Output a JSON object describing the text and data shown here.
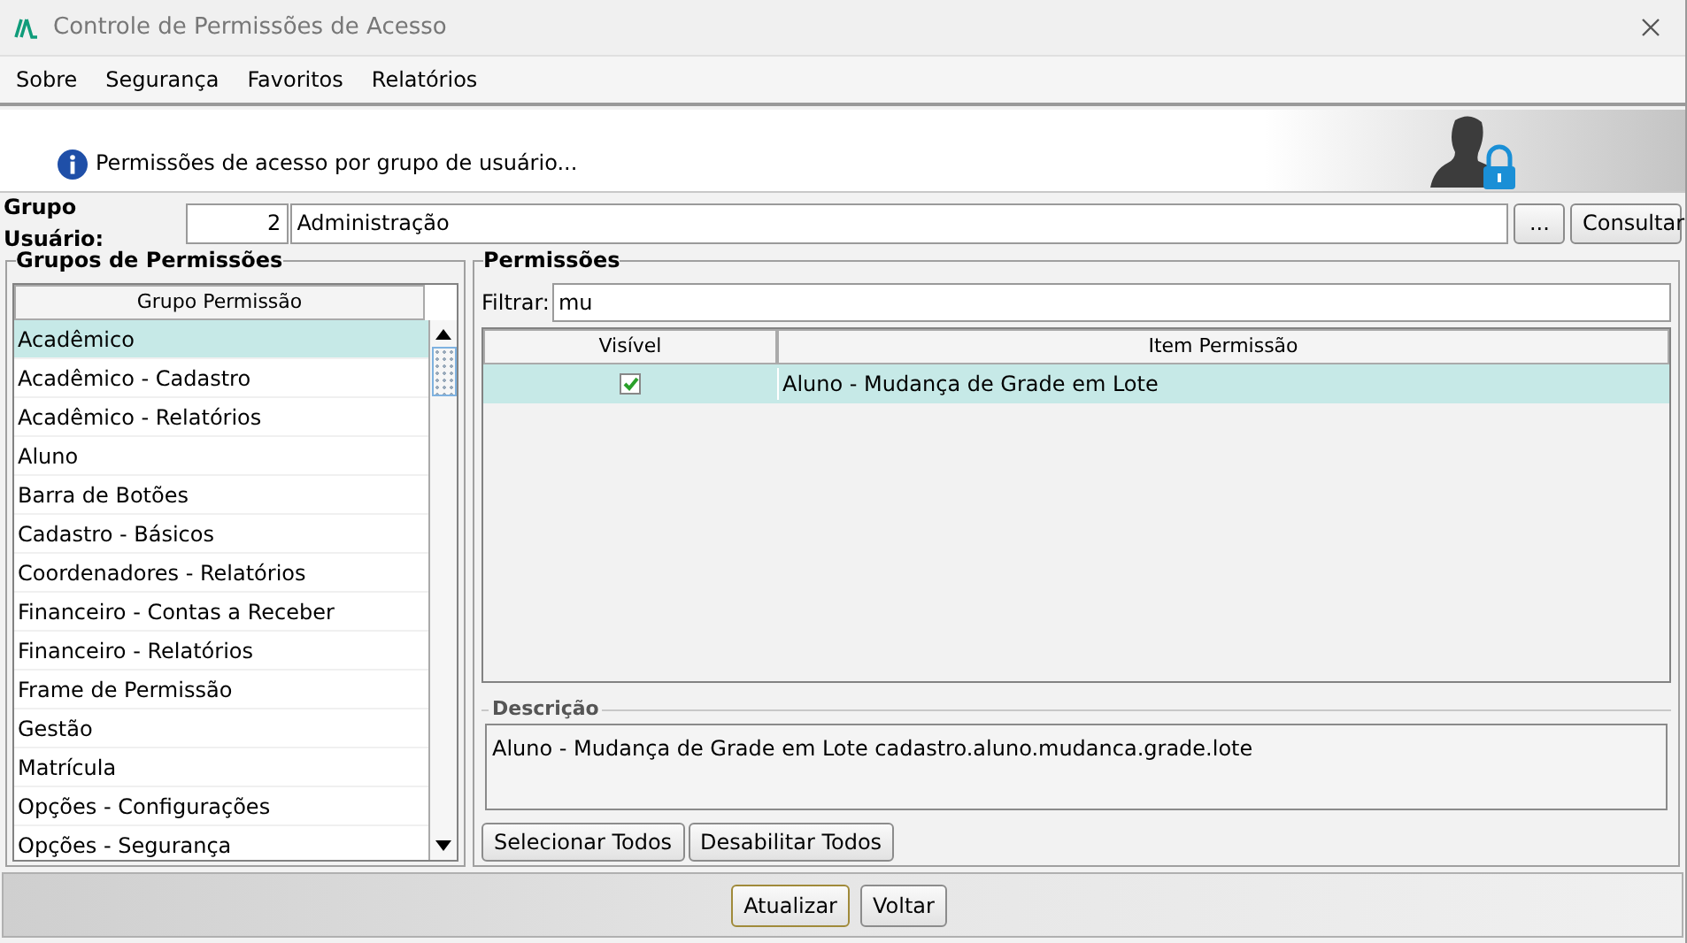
{
  "window": {
    "title": "Controle de Permissões de Acesso"
  },
  "menu": [
    "Sobre",
    "Segurança",
    "Favoritos",
    "Relatórios"
  ],
  "header": {
    "message": "Permissões de acesso por grupo de usuário..."
  },
  "user_group": {
    "label": "Grupo Usuário:",
    "code": "2",
    "name": "Administração",
    "browse_button": "...",
    "query_button": "Consultar"
  },
  "groups_panel": {
    "title": "Grupos de Permissões",
    "column": "Grupo Permissão",
    "items": [
      {
        "label": "Acadêmico",
        "selected": true
      },
      {
        "label": "Acadêmico - Cadastro",
        "selected": false
      },
      {
        "label": "Acadêmico - Relatórios",
        "selected": false
      },
      {
        "label": "Aluno",
        "selected": false
      },
      {
        "label": "Barra de Botões",
        "selected": false
      },
      {
        "label": "Cadastro - Básicos",
        "selected": false
      },
      {
        "label": "Coordenadores - Relatórios",
        "selected": false
      },
      {
        "label": "Financeiro - Contas a Receber",
        "selected": false
      },
      {
        "label": "Financeiro - Relatórios",
        "selected": false
      },
      {
        "label": "Frame de Permissão",
        "selected": false
      },
      {
        "label": "Gestão",
        "selected": false
      },
      {
        "label": "Matrícula",
        "selected": false
      },
      {
        "label": "Opções - Configurações",
        "selected": false
      },
      {
        "label": "Opções - Segurança",
        "selected": false
      }
    ]
  },
  "permissions_panel": {
    "title": "Permissões",
    "filter_label": "Filtrar:",
    "filter_value": "mu",
    "columns": [
      "Visível",
      "Item Permissão"
    ],
    "rows": [
      {
        "checked": true,
        "item": "Aluno - Mudança de Grade em Lote",
        "selected": true
      }
    ],
    "description_title": "Descrição",
    "description": "Aluno - Mudança de Grade em Lote cadastro.aluno.mudanca.grade.lote",
    "buttons": [
      "Selecionar Todos",
      "Desabilitar Todos"
    ]
  },
  "footer_buttons": [
    {
      "label": "Atualizar",
      "kind": "primary"
    },
    {
      "label": "Voltar",
      "kind": "normal"
    }
  ]
}
